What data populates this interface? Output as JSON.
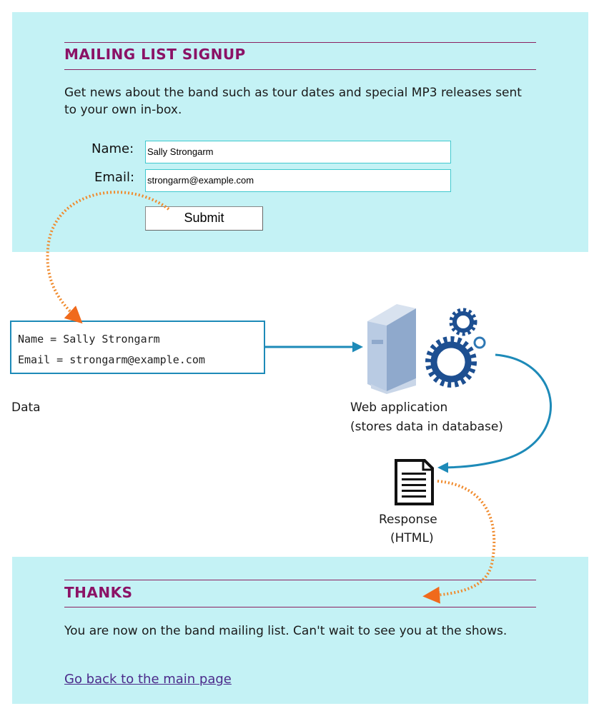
{
  "signup": {
    "heading": "MAILING LIST SIGNUP",
    "description": "Get news about the band such as tour dates and special MP3 releases sent to your own in-box.",
    "name_label": "Name:",
    "name_value": "Sally Strongarm",
    "email_label": "Email:",
    "email_value": "strongarm@example.com",
    "submit_label": "Submit"
  },
  "data_box": {
    "line1": "Name = Sally Strongarm",
    "line2": "Email = strongarm@example.com"
  },
  "labels": {
    "data": "Data",
    "web_app_line1": "Web application",
    "web_app_line2": "(stores data in database)",
    "response_line1": "Response",
    "response_line2": "(HTML)"
  },
  "thanks": {
    "heading": "THANKS",
    "message": "You are now on the band mailing list. Can't wait to see you at the shows.",
    "link": "Go back to the main page"
  },
  "colors": {
    "panel_bg": "#c4f2f5",
    "heading": "#8b1266",
    "flow_arrow": "#1d8ab8",
    "dotted_arrow": "#f08a2c",
    "server": "#a9bfdc",
    "gears": "#1d4f91"
  },
  "icons": [
    "server-icon",
    "gears-icon",
    "document-icon"
  ]
}
